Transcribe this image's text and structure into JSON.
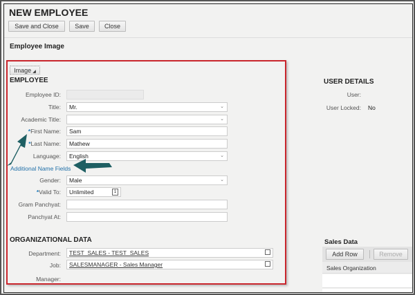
{
  "header": {
    "title": "NEW EMPLOYEE",
    "buttons": [
      "Save and Close",
      "Save",
      "Close"
    ]
  },
  "employee_image": {
    "title": "Employee Image",
    "image_button": "Image"
  },
  "employee": {
    "title": "EMPLOYEE",
    "fields": {
      "employee_id": {
        "label": "Employee ID:",
        "value": ""
      },
      "title": {
        "label": "Title:",
        "value": "Mr."
      },
      "academic_title": {
        "label": "Academic Title:",
        "value": ""
      },
      "first_name": {
        "label": "First Name:",
        "value": "Sam",
        "required": "*"
      },
      "last_name": {
        "label": "Last Name:",
        "value": "Mathew",
        "required": "*"
      },
      "language": {
        "label": "Language:",
        "value": "English"
      },
      "gender": {
        "label": "Gender:",
        "value": "Male"
      },
      "valid_to": {
        "label": "Valid To:",
        "value": "Unlimited",
        "required": "*"
      },
      "gram_panchyat": {
        "label": "Gram Panchyat:",
        "value": ""
      },
      "panchyat_at": {
        "label": "Panchyat At:",
        "value": ""
      }
    },
    "additional_link": "Additional Name Fields"
  },
  "org": {
    "title": "ORGANIZATIONAL DATA",
    "department": {
      "label": "Department:",
      "value": "TEST_SALES - TEST_SALES"
    },
    "job": {
      "label": "Job:",
      "value": "SALESMANAGER - Sales Manager"
    },
    "manager": {
      "label": "Manager:",
      "value": ""
    }
  },
  "user_details": {
    "title": "USER DETAILS",
    "user_label": "User:",
    "user_value": "",
    "locked_label": "User Locked:",
    "locked_value": "No"
  },
  "sales": {
    "title": "Sales Data",
    "add_row": "Add Row",
    "remove": "Remove",
    "column": "Sales Organization"
  },
  "colors": {
    "highlight_border": "#c9252c",
    "arrow": "#1e5f63",
    "link": "#1f6fa8",
    "required": "#1f7ab8"
  }
}
